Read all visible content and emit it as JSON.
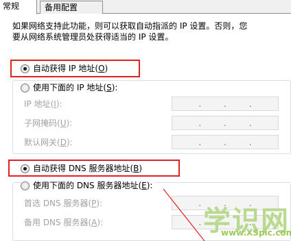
{
  "tabs": [
    {
      "label": "常规",
      "active": true
    },
    {
      "label": "备用配置",
      "active": false
    }
  ],
  "description": {
    "line1": "如果网络支持此功能，则可以获取自动指派的 IP 设置。否则，您",
    "line2": "要从网络系统管理员处获得适当的 IP 设置。"
  },
  "ip": {
    "auto_label": "自动获得 IP 地址(O)",
    "auto_pre": "自动获得 IP 地址(",
    "auto_key": "O",
    "auto_post": ")",
    "auto_selected": true,
    "manual_pre": "使用下面的 IP 地址(",
    "manual_key": "S",
    "manual_post": "):",
    "manual_selected": false,
    "fields": [
      {
        "pre": "IP 地址(",
        "key": "I",
        "post": "):",
        "value": ".   .   ."
      },
      {
        "pre": "子网掩码(",
        "key": "U",
        "post": "):",
        "value": ".   .   ."
      },
      {
        "pre": "默认网关(",
        "key": "D",
        "post": "):",
        "value": ".   .   ."
      }
    ]
  },
  "dns": {
    "auto_pre": "自动获得 DNS 服务器地址(",
    "auto_key": "B",
    "auto_post": ")",
    "auto_selected": true,
    "manual_pre": "使用下面的 DNS 服务器地址(",
    "manual_key": "E",
    "manual_post": "):",
    "manual_selected": false,
    "fields": [
      {
        "pre": "首选 DNS 服务器(",
        "key": "P",
        "post": "):",
        "value": ".   .   ."
      },
      {
        "pre": "备用 DNS 服务器(",
        "key": "A",
        "post": "):",
        "value": ".   .   ."
      }
    ]
  },
  "watermark": {
    "text": "学识网",
    "url": "www.XSpic.com"
  },
  "colors": {
    "highlight_border": "#e02020",
    "watermark": "#b9d98e",
    "arrow": "#e02020"
  }
}
